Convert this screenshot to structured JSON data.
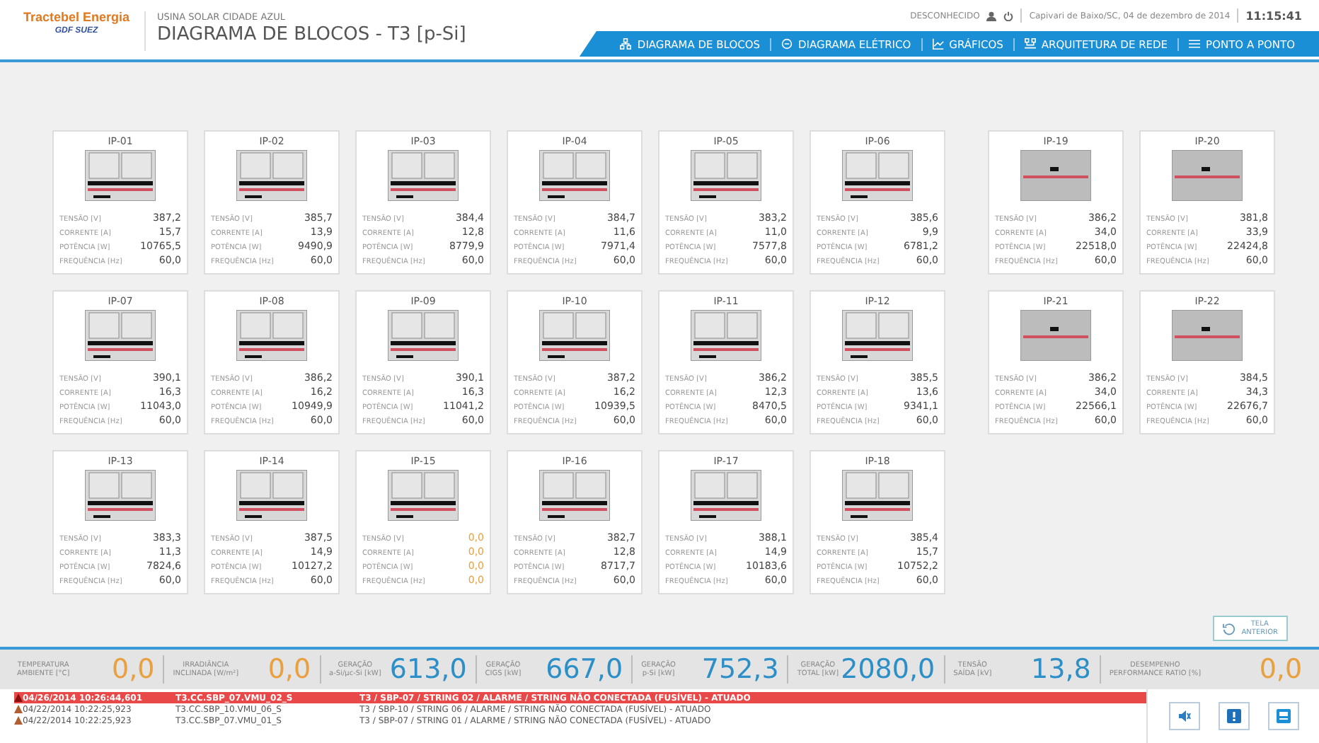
{
  "header": {
    "logo": {
      "brand": "Tractebel Energia",
      "group": "GDF SUEZ"
    },
    "subtitle": "USINA SOLAR CIDADE AZUL",
    "title": "DIAGRAMA DE BLOCOS - T3 [p-Si]",
    "user": "DESCONHECIDO",
    "location_date": "Capivari de Baixo/SC, 04 de dezembro de 2014",
    "time": "11:15:41"
  },
  "nav": [
    {
      "label": "DIAGRAMA DE BLOCOS"
    },
    {
      "label": "DIAGRAMA ELÉTRICO"
    },
    {
      "label": "GRÁFICOS"
    },
    {
      "label": "ARQUITETURA DE REDE"
    },
    {
      "label": "PONTO A PONTO"
    }
  ],
  "block_groups": [
    {
      "blocks": [
        {
          "name": "IP-01",
          "kind": "dual",
          "offline": false,
          "readings": [
            {
              "label": "TENSÃO [V]",
              "value": "387,2"
            },
            {
              "label": "CORRENTE [A]",
              "value": "15,7"
            },
            {
              "label": "POTÊNCIA [W]",
              "value": "10765,5"
            },
            {
              "label": "FREQUÊNCIA [Hz]",
              "value": "60,0"
            }
          ]
        },
        {
          "name": "IP-02",
          "kind": "dual",
          "offline": false,
          "readings": [
            {
              "label": "TENSÃO [V]",
              "value": "385,7"
            },
            {
              "label": "CORRENTE [A]",
              "value": "13,9"
            },
            {
              "label": "POTÊNCIA [W]",
              "value": "9490,9"
            },
            {
              "label": "FREQUÊNCIA [Hz]",
              "value": "60,0"
            }
          ]
        },
        {
          "name": "IP-03",
          "kind": "dual",
          "offline": false,
          "readings": [
            {
              "label": "TENSÃO [V]",
              "value": "384,4"
            },
            {
              "label": "CORRENTE [A]",
              "value": "12,8"
            },
            {
              "label": "POTÊNCIA [W]",
              "value": "8779,9"
            },
            {
              "label": "FREQUÊNCIA [Hz]",
              "value": "60,0"
            }
          ]
        },
        {
          "name": "IP-04",
          "kind": "dual",
          "offline": false,
          "readings": [
            {
              "label": "TENSÃO [V]",
              "value": "384,7"
            },
            {
              "label": "CORRENTE [A]",
              "value": "11,6"
            },
            {
              "label": "POTÊNCIA [W]",
              "value": "7971,4"
            },
            {
              "label": "FREQUÊNCIA [Hz]",
              "value": "60,0"
            }
          ]
        },
        {
          "name": "IP-05",
          "kind": "dual",
          "offline": false,
          "readings": [
            {
              "label": "TENSÃO [V]",
              "value": "383,2"
            },
            {
              "label": "CORRENTE [A]",
              "value": "11,0"
            },
            {
              "label": "POTÊNCIA [W]",
              "value": "7577,8"
            },
            {
              "label": "FREQUÊNCIA [Hz]",
              "value": "60,0"
            }
          ]
        },
        {
          "name": "IP-06",
          "kind": "dual",
          "offline": false,
          "readings": [
            {
              "label": "TENSÃO [V]",
              "value": "385,6"
            },
            {
              "label": "CORRENTE [A]",
              "value": "9,9"
            },
            {
              "label": "POTÊNCIA [W]",
              "value": "6781,2"
            },
            {
              "label": "FREQUÊNCIA [Hz]",
              "value": "60,0"
            }
          ]
        },
        {
          "name": "IP-07",
          "kind": "dual",
          "offline": false,
          "readings": [
            {
              "label": "TENSÃO [V]",
              "value": "390,1"
            },
            {
              "label": "CORRENTE [A]",
              "value": "16,3"
            },
            {
              "label": "POTÊNCIA [W]",
              "value": "11043,0"
            },
            {
              "label": "FREQUÊNCIA [Hz]",
              "value": "60,0"
            }
          ]
        },
        {
          "name": "IP-08",
          "kind": "dual",
          "offline": false,
          "readings": [
            {
              "label": "TENSÃO [V]",
              "value": "386,2"
            },
            {
              "label": "CORRENTE [A]",
              "value": "16,2"
            },
            {
              "label": "POTÊNCIA [W]",
              "value": "10949,9"
            },
            {
              "label": "FREQUÊNCIA [Hz]",
              "value": "60,0"
            }
          ]
        },
        {
          "name": "IP-09",
          "kind": "dual",
          "offline": false,
          "readings": [
            {
              "label": "TENSÃO [V]",
              "value": "390,1"
            },
            {
              "label": "CORRENTE [A]",
              "value": "16,3"
            },
            {
              "label": "POTÊNCIA [W]",
              "value": "11041,2"
            },
            {
              "label": "FREQUÊNCIA [Hz]",
              "value": "60,0"
            }
          ]
        },
        {
          "name": "IP-10",
          "kind": "dual",
          "offline": false,
          "readings": [
            {
              "label": "TENSÃO [V]",
              "value": "387,2"
            },
            {
              "label": "CORRENTE [A]",
              "value": "16,2"
            },
            {
              "label": "POTÊNCIA [W]",
              "value": "10939,5"
            },
            {
              "label": "FREQUÊNCIA [Hz]",
              "value": "60,0"
            }
          ]
        },
        {
          "name": "IP-11",
          "kind": "dual",
          "offline": false,
          "readings": [
            {
              "label": "TENSÃO [V]",
              "value": "386,2"
            },
            {
              "label": "CORRENTE [A]",
              "value": "12,3"
            },
            {
              "label": "POTÊNCIA [W]",
              "value": "8470,5"
            },
            {
              "label": "FREQUÊNCIA [Hz]",
              "value": "60,0"
            }
          ]
        },
        {
          "name": "IP-12",
          "kind": "dual",
          "offline": false,
          "readings": [
            {
              "label": "TENSÃO [V]",
              "value": "385,5"
            },
            {
              "label": "CORRENTE [A]",
              "value": "13,6"
            },
            {
              "label": "POTÊNCIA [W]",
              "value": "9341,1"
            },
            {
              "label": "FREQUÊNCIA [Hz]",
              "value": "60,0"
            }
          ]
        },
        {
          "name": "IP-13",
          "kind": "dual",
          "offline": false,
          "readings": [
            {
              "label": "TENSÃO [V]",
              "value": "383,3"
            },
            {
              "label": "CORRENTE [A]",
              "value": "11,3"
            },
            {
              "label": "POTÊNCIA [W]",
              "value": "7824,6"
            },
            {
              "label": "FREQUÊNCIA [Hz]",
              "value": "60,0"
            }
          ]
        },
        {
          "name": "IP-14",
          "kind": "dual",
          "offline": false,
          "readings": [
            {
              "label": "TENSÃO [V]",
              "value": "387,5"
            },
            {
              "label": "CORRENTE [A]",
              "value": "14,9"
            },
            {
              "label": "POTÊNCIA [W]",
              "value": "10127,2"
            },
            {
              "label": "FREQUÊNCIA [Hz]",
              "value": "60,0"
            }
          ]
        },
        {
          "name": "IP-15",
          "kind": "dual",
          "offline": true,
          "readings": [
            {
              "label": "TENSÃO [V]",
              "value": "0,0"
            },
            {
              "label": "CORRENTE [A]",
              "value": "0,0"
            },
            {
              "label": "POTÊNCIA [W]",
              "value": "0,0"
            },
            {
              "label": "FREQUÊNCIA [Hz]",
              "value": "0,0"
            }
          ]
        },
        {
          "name": "IP-16",
          "kind": "dual",
          "offline": false,
          "readings": [
            {
              "label": "TENSÃO [V]",
              "value": "382,7"
            },
            {
              "label": "CORRENTE [A]",
              "value": "12,8"
            },
            {
              "label": "POTÊNCIA [W]",
              "value": "8717,7"
            },
            {
              "label": "FREQUÊNCIA [Hz]",
              "value": "60,0"
            }
          ]
        },
        {
          "name": "IP-17",
          "kind": "dual",
          "offline": false,
          "readings": [
            {
              "label": "TENSÃO [V]",
              "value": "388,1"
            },
            {
              "label": "CORRENTE [A]",
              "value": "14,9"
            },
            {
              "label": "POTÊNCIA [W]",
              "value": "10183,6"
            },
            {
              "label": "FREQUÊNCIA [Hz]",
              "value": "60,0"
            }
          ]
        },
        {
          "name": "IP-18",
          "kind": "dual",
          "offline": false,
          "readings": [
            {
              "label": "TENSÃO [V]",
              "value": "385,4"
            },
            {
              "label": "CORRENTE [A]",
              "value": "15,7"
            },
            {
              "label": "POTÊNCIA [W]",
              "value": "10752,2"
            },
            {
              "label": "FREQUÊNCIA [Hz]",
              "value": "60,0"
            }
          ]
        }
      ]
    },
    {
      "blocks": [
        {
          "name": "IP-19",
          "kind": "single",
          "offline": false,
          "readings": [
            {
              "label": "TENSÃO [V]",
              "value": "386,2"
            },
            {
              "label": "CORRENTE [A]",
              "value": "34,0"
            },
            {
              "label": "POTÊNCIA [W]",
              "value": "22518,0"
            },
            {
              "label": "FREQUÊNCIA [Hz]",
              "value": "60,0"
            }
          ]
        },
        {
          "name": "IP-20",
          "kind": "single",
          "offline": false,
          "readings": [
            {
              "label": "TENSÃO [V]",
              "value": "381,8"
            },
            {
              "label": "CORRENTE [A]",
              "value": "33,9"
            },
            {
              "label": "POTÊNCIA [W]",
              "value": "22424,8"
            },
            {
              "label": "FREQUÊNCIA [Hz]",
              "value": "60,0"
            }
          ]
        },
        {
          "name": "IP-21",
          "kind": "single",
          "offline": false,
          "readings": [
            {
              "label": "TENSÃO [V]",
              "value": "386,2"
            },
            {
              "label": "CORRENTE [A]",
              "value": "34,0"
            },
            {
              "label": "POTÊNCIA [W]",
              "value": "22566,1"
            },
            {
              "label": "FREQUÊNCIA [Hz]",
              "value": "60,0"
            }
          ]
        },
        {
          "name": "IP-22",
          "kind": "single",
          "offline": false,
          "readings": [
            {
              "label": "TENSÃO [V]",
              "value": "384,5"
            },
            {
              "label": "CORRENTE [A]",
              "value": "34,3"
            },
            {
              "label": "POTÊNCIA [W]",
              "value": "22676,7"
            },
            {
              "label": "FREQUÊNCIA [Hz]",
              "value": "60,0"
            }
          ]
        }
      ]
    }
  ],
  "back_button": {
    "lines": [
      "TELA",
      "ANTERIOR"
    ]
  },
  "stats": [
    {
      "label_lines": [
        "TEMPERATURA",
        "AMBIENTE [°C]"
      ],
      "value": "0,0",
      "color": "#e8a040"
    },
    {
      "label_lines": [
        "IRRADIÂNCIA",
        "INCLINADA [W/m²]"
      ],
      "value": "0,0",
      "color": "#e8a040"
    },
    {
      "label_lines": [
        "GERAÇÃO",
        "a-Si/µc-Si [kW]"
      ],
      "value": "613,0",
      "color": "#2d8fc8"
    },
    {
      "label_lines": [
        "GERAÇÃO",
        "CIGS [kW]"
      ],
      "value": "667,0",
      "color": "#2d8fc8"
    },
    {
      "label_lines": [
        "GERAÇÃO",
        "p-Si [kW]"
      ],
      "value": "752,3",
      "color": "#2d8fc8"
    },
    {
      "label_lines": [
        "GERAÇÃO",
        "TOTAL [kW]"
      ],
      "value": "2080,0",
      "color": "#2d8fc8"
    },
    {
      "label_lines": [
        "TENSÃO",
        "SAÍDA [kV]"
      ],
      "value": "13,8",
      "color": "#2d8fc8"
    },
    {
      "label_lines": [
        "DESEMPENHO",
        "PERFORMANCE RATIO [%]"
      ],
      "value": "0,0",
      "color": "#e8a040"
    }
  ],
  "alarms": [
    {
      "time": "04/26/2014 10:26:44,601",
      "tag": "T3.CC.SBP_07.VMU_02_S",
      "message": "T3 / SBP-07 / STRING 02 / ALARME / STRING NÃO CONECTADA (FUSÍVEL) - ATUADO",
      "selected": true
    },
    {
      "time": "04/22/2014 10:22:25,923",
      "tag": "T3.CC.SBP_10.VMU_06_S",
      "message": "T3 / SBP-10 / STRING 06 / ALARME / STRING NÃO CONECTADA (FUSÍVEL) - ATUADO",
      "selected": false
    },
    {
      "time": "04/22/2014 10:22:25,923",
      "tag": "T3.CC.SBP_07.VMU_01_S",
      "message": "T3 / SBP-07 / STRING 01 / ALARME / STRING NÃO CONECTADA (FUSÍVEL) - ATUADO",
      "selected": false
    }
  ]
}
